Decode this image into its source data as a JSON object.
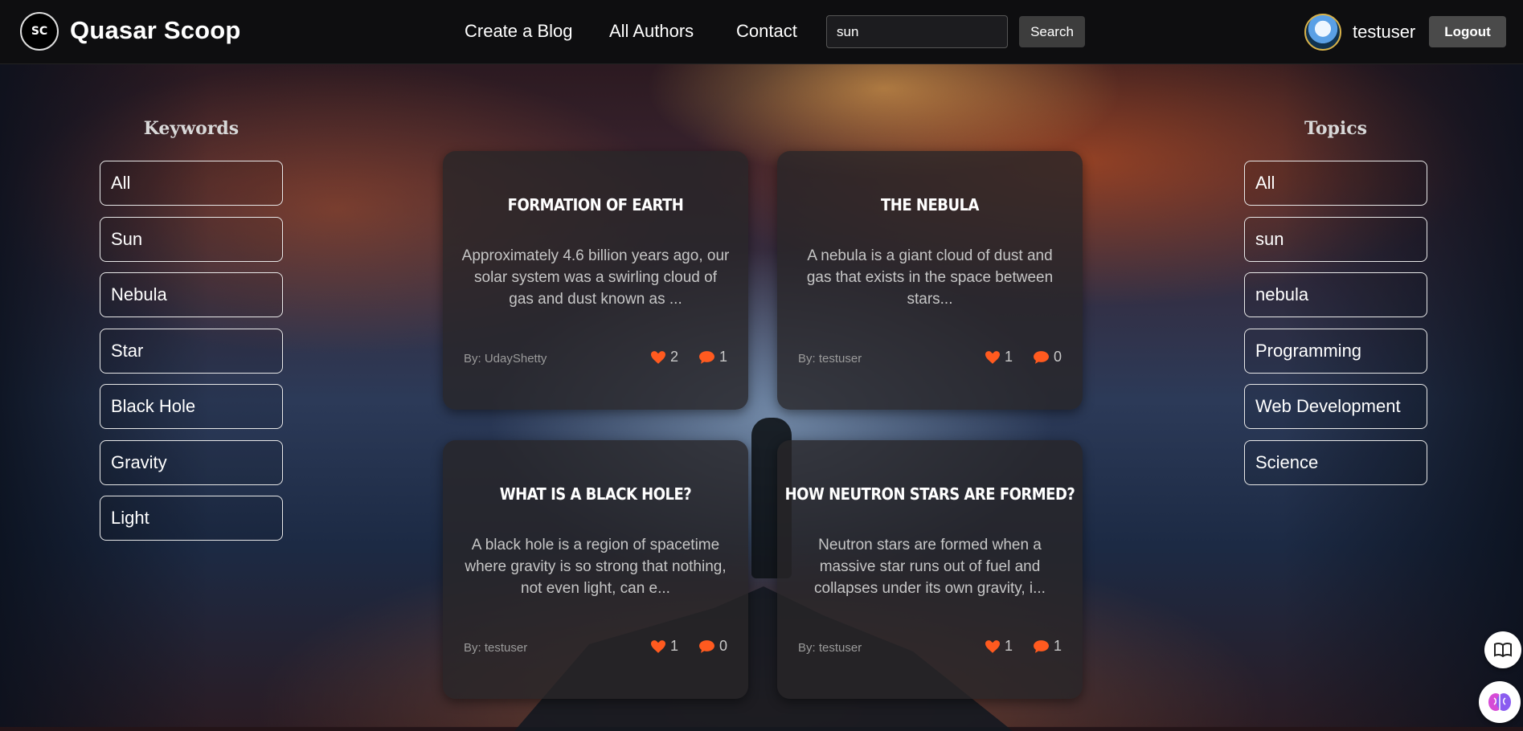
{
  "navbar": {
    "logo_text": "SC",
    "brand": "Quasar Scoop",
    "links": [
      "Create a Blog",
      "All Authors",
      "Contact"
    ],
    "search_value": "sun",
    "search_button": "Search",
    "username": "testuser",
    "logout": "Logout"
  },
  "keywords": {
    "title": "Keywords",
    "items": [
      "All",
      "Sun",
      "Nebula",
      "Star",
      "Black Hole",
      "Gravity",
      "Light"
    ]
  },
  "topics": {
    "title": "Topics",
    "items": [
      "All",
      "sun",
      "nebula",
      "Programming",
      "Web Development",
      "Science"
    ]
  },
  "cards": [
    {
      "title": "FORMATION OF EARTH",
      "description": "Approximately 4.6 billion years ago, our solar system was a swirling cloud of gas and dust known as ...",
      "author": "By: UdayShetty",
      "likes": "2",
      "comments": "1"
    },
    {
      "title": "THE NEBULA",
      "description": "A nebula is a giant cloud of dust and gas that exists in the space between stars...",
      "author": "By: testuser",
      "likes": "1",
      "comments": "0"
    },
    {
      "title": "WHAT IS A BLACK HOLE?",
      "description": "A black hole is a region of spacetime where gravity is so strong that nothing, not even light, can e...",
      "author": "By: testuser",
      "likes": "1",
      "comments": "0"
    },
    {
      "title": "HOW NEUTRON STARS ARE FORMED?",
      "description": "Neutron stars are formed when a massive star runs out of fuel and collapses under its own gravity, i...",
      "author": "By: testuser",
      "likes": "1",
      "comments": "1"
    }
  ],
  "colors": {
    "accent": "#ff5a1f",
    "navbar": "#0e0e10",
    "card": "#282628"
  },
  "icons": {
    "like": "heart-icon",
    "comment": "comment-icon",
    "reader": "book-open-icon",
    "ai": "brain-icon"
  }
}
